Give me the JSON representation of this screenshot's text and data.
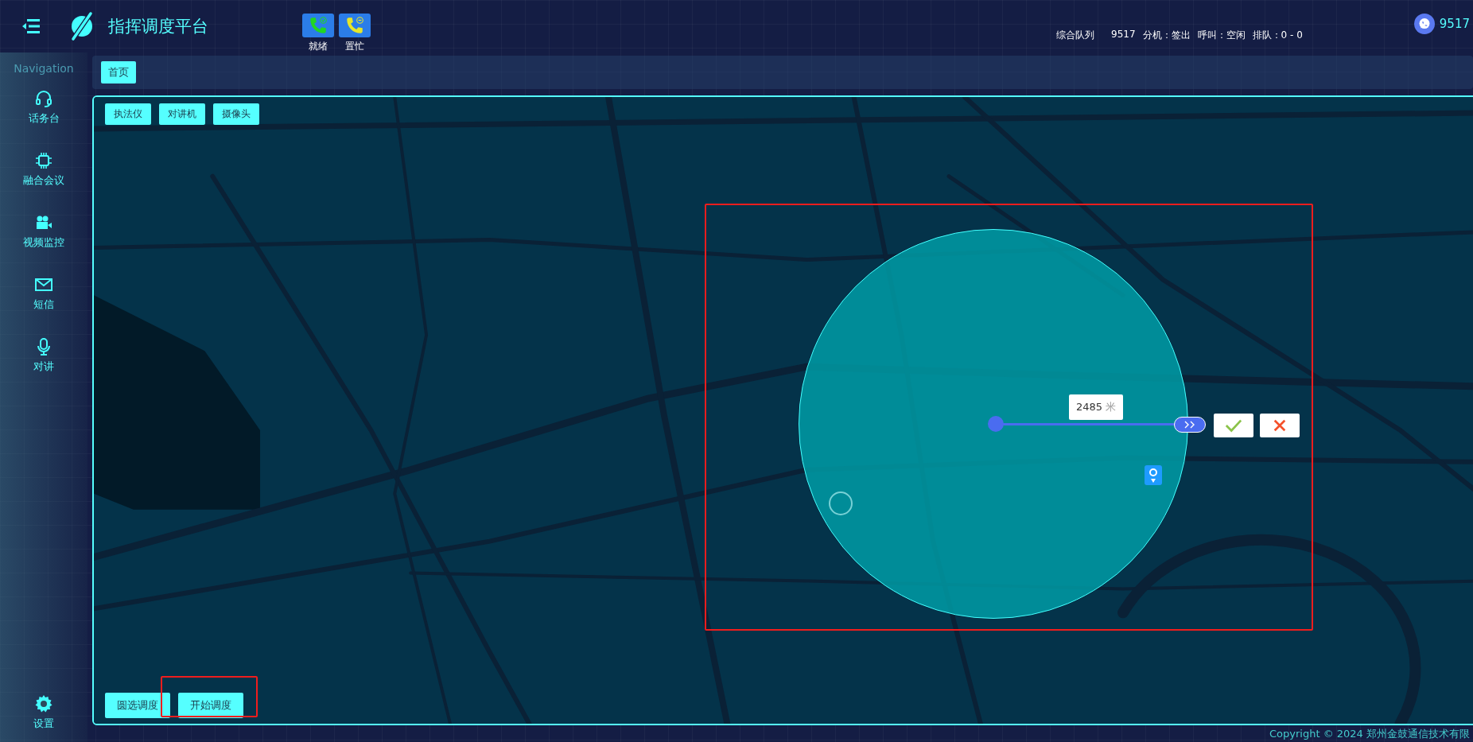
{
  "header": {
    "title": "指挥调度平台",
    "status_buttons": [
      {
        "label": "就绪",
        "kind": "ready"
      },
      {
        "label": "置忙",
        "kind": "busy"
      }
    ],
    "queue": {
      "label": "综合队列",
      "number": "9517",
      "items": [
        "分机：签出",
        "呼叫：空闲",
        "排队：0 - 0"
      ]
    },
    "user": "9517"
  },
  "sidebar": {
    "heading": "Navigation",
    "items": [
      {
        "label": "话务台"
      },
      {
        "label": "融合会议"
      },
      {
        "label": "视频监控"
      },
      {
        "label": "短信"
      },
      {
        "label": "对讲"
      }
    ],
    "settings": "设置"
  },
  "tabs": [
    {
      "label": "首页",
      "selected": true
    }
  ],
  "map": {
    "top_buttons": [
      "执法仪",
      "对讲机",
      "摄像头"
    ],
    "bottom_buttons": [
      "圆选调度",
      "开始调度"
    ],
    "distance": "2485",
    "unit": "米"
  },
  "footer": {
    "copyright": "Copyright © 2024 郑州金鼓通信技术有限"
  }
}
